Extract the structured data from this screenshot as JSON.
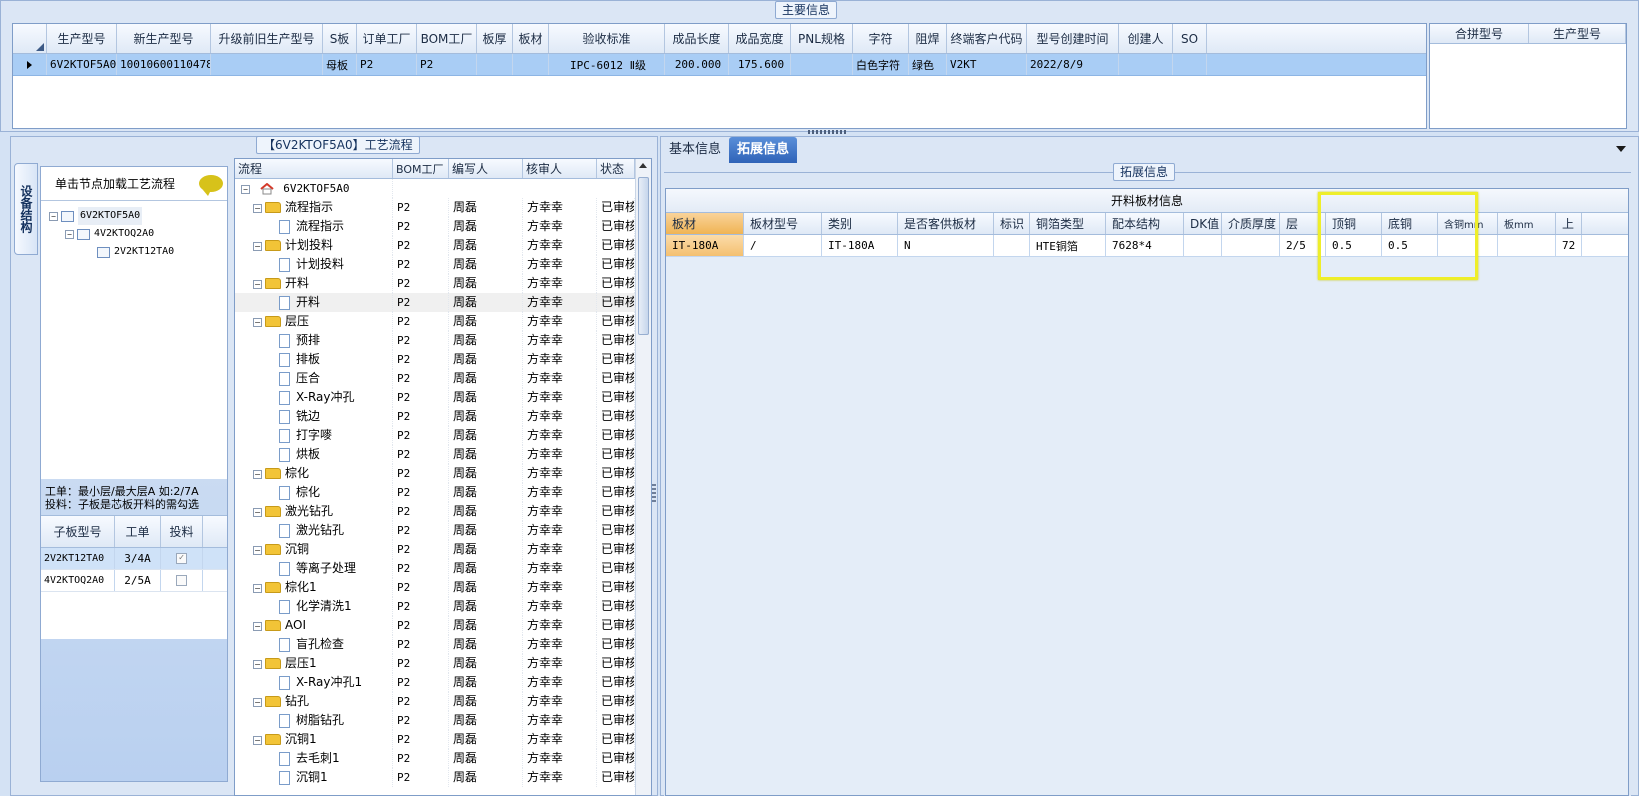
{
  "main_info": {
    "title": "主要信息",
    "columns": [
      "生产型号",
      "新生产型号",
      "升级前旧生产型号",
      "S板",
      "订单工厂",
      "BOM工厂",
      "板厚",
      "板材",
      "验收标准",
      "成品长度",
      "成品宽度",
      "PNL规格",
      "字符",
      "阻焊",
      "终端客户代码",
      "型号创建时间",
      "创建人",
      "SO"
    ],
    "row": [
      "6V2KTOF5A0",
      "10010600110478",
      "",
      "母板",
      "P2",
      "P2",
      "",
      "",
      "IPC-6012 Ⅱ级",
      "200.000",
      "175.600",
      "",
      "白色字符",
      "绿色",
      "V2KT",
      "2022/8/9",
      "",
      ""
    ],
    "right_columns": [
      "合拼型号",
      "生产型号"
    ]
  },
  "structure": {
    "vtab_label": "设备结构",
    "hint": "单击节点加载工艺流程",
    "nodes": [
      "6V2KTOF5A0",
      "4V2KTOQ2A0",
      "2V2KT12TA0"
    ],
    "note_line1": "工单：最小层/最大层A 如:2/7A",
    "note_line2": "投料：子板是芯板开料的需勾选",
    "sub_columns": [
      "子板型号",
      "工单",
      "投料"
    ],
    "sub_rows": [
      {
        "model": "2V2KT12TA0",
        "order": "3/4A",
        "checked": true
      },
      {
        "model": "4V2KTOQ2A0",
        "order": "2/5A",
        "checked": false
      }
    ]
  },
  "flow": {
    "title": "【6V2KTOF5A0】工艺流程",
    "columns": [
      "流程",
      "BOM工厂",
      "编写人",
      "核审人",
      "状态"
    ],
    "root": "6V2KTOF5A0",
    "rows": [
      {
        "name": "流程指示",
        "type": "folder",
        "bom": "P2",
        "writer": "周磊",
        "reviewer": "方幸幸",
        "status": "已审核"
      },
      {
        "name": "流程指示",
        "type": "doc",
        "bom": "P2",
        "writer": "周磊",
        "reviewer": "方幸幸",
        "status": "已审核"
      },
      {
        "name": "计划投料",
        "type": "folder",
        "bom": "P2",
        "writer": "周磊",
        "reviewer": "方幸幸",
        "status": "已审核"
      },
      {
        "name": "计划投料",
        "type": "doc",
        "bom": "P2",
        "writer": "周磊",
        "reviewer": "方幸幸",
        "status": "已审核"
      },
      {
        "name": "开料",
        "type": "folder",
        "bom": "P2",
        "writer": "周磊",
        "reviewer": "方幸幸",
        "status": "已审核"
      },
      {
        "name": "开料",
        "type": "doc",
        "bom": "P2",
        "writer": "周磊",
        "reviewer": "方幸幸",
        "status": "已审核",
        "selected": true
      },
      {
        "name": "层压",
        "type": "folder",
        "bom": "P2",
        "writer": "周磊",
        "reviewer": "方幸幸",
        "status": "已审核"
      },
      {
        "name": "预排",
        "type": "doc",
        "bom": "P2",
        "writer": "周磊",
        "reviewer": "方幸幸",
        "status": "已审核"
      },
      {
        "name": "排板",
        "type": "doc",
        "bom": "P2",
        "writer": "周磊",
        "reviewer": "方幸幸",
        "status": "已审核"
      },
      {
        "name": "压合",
        "type": "doc",
        "bom": "P2",
        "writer": "周磊",
        "reviewer": "方幸幸",
        "status": "已审核"
      },
      {
        "name": "X-Ray冲孔",
        "type": "doc",
        "bom": "P2",
        "writer": "周磊",
        "reviewer": "方幸幸",
        "status": "已审核"
      },
      {
        "name": "铣边",
        "type": "doc",
        "bom": "P2",
        "writer": "周磊",
        "reviewer": "方幸幸",
        "status": "已审核"
      },
      {
        "name": "打字嘜",
        "type": "doc",
        "bom": "P2",
        "writer": "周磊",
        "reviewer": "方幸幸",
        "status": "已审核"
      },
      {
        "name": "烘板",
        "type": "doc",
        "bom": "P2",
        "writer": "周磊",
        "reviewer": "方幸幸",
        "status": "已审核"
      },
      {
        "name": "棕化",
        "type": "folder",
        "bom": "P2",
        "writer": "周磊",
        "reviewer": "方幸幸",
        "status": "已审核"
      },
      {
        "name": "棕化",
        "type": "doc",
        "bom": "P2",
        "writer": "周磊",
        "reviewer": "方幸幸",
        "status": "已审核"
      },
      {
        "name": "激光钻孔",
        "type": "folder",
        "bom": "P2",
        "writer": "周磊",
        "reviewer": "方幸幸",
        "status": "已审核"
      },
      {
        "name": "激光钻孔",
        "type": "doc",
        "bom": "P2",
        "writer": "周磊",
        "reviewer": "方幸幸",
        "status": "已审核"
      },
      {
        "name": "沉铜",
        "type": "folder",
        "bom": "P2",
        "writer": "周磊",
        "reviewer": "方幸幸",
        "status": "已审核"
      },
      {
        "name": "等离子处理",
        "type": "doc",
        "bom": "P2",
        "writer": "周磊",
        "reviewer": "方幸幸",
        "status": "已审核"
      },
      {
        "name": "棕化1",
        "type": "folder",
        "bom": "P2",
        "writer": "周磊",
        "reviewer": "方幸幸",
        "status": "已审核"
      },
      {
        "name": "化学清洗1",
        "type": "doc",
        "bom": "P2",
        "writer": "周磊",
        "reviewer": "方幸幸",
        "status": "已审核"
      },
      {
        "name": "AOI",
        "type": "folder",
        "bom": "P2",
        "writer": "周磊",
        "reviewer": "方幸幸",
        "status": "已审核"
      },
      {
        "name": "盲孔检查",
        "type": "doc",
        "bom": "P2",
        "writer": "周磊",
        "reviewer": "方幸幸",
        "status": "已审核"
      },
      {
        "name": "层压1",
        "type": "folder",
        "bom": "P2",
        "writer": "周磊",
        "reviewer": "方幸幸",
        "status": "已审核"
      },
      {
        "name": "X-Ray冲孔1",
        "type": "doc",
        "bom": "P2",
        "writer": "周磊",
        "reviewer": "方幸幸",
        "status": "已审核"
      },
      {
        "name": "钻孔",
        "type": "folder",
        "bom": "P2",
        "writer": "周磊",
        "reviewer": "方幸幸",
        "status": "已审核"
      },
      {
        "name": "树脂钻孔",
        "type": "doc",
        "bom": "P2",
        "writer": "周磊",
        "reviewer": "方幸幸",
        "status": "已审核"
      },
      {
        "name": "沉铜1",
        "type": "folder",
        "bom": "P2",
        "writer": "周磊",
        "reviewer": "方幸幸",
        "status": "已审核"
      },
      {
        "name": "去毛刺1",
        "type": "doc",
        "bom": "P2",
        "writer": "周磊",
        "reviewer": "方幸幸",
        "status": "已审核"
      },
      {
        "name": "沉铜1",
        "type": "doc",
        "bom": "P2",
        "writer": "周磊",
        "reviewer": "方幸幸",
        "status": "已审核"
      }
    ]
  },
  "tabs": {
    "basic": "基本信息",
    "ext": "拓展信息"
  },
  "ext_info": {
    "title": "拓展信息",
    "material_title": "开料板材信息",
    "columns": [
      "板材",
      "板材型号",
      "类别",
      "是否客供板材",
      "标识",
      "铜箔类型",
      "配本结构",
      "DK值",
      "介质厚度",
      "层",
      "顶铜",
      "底铜",
      "含铜mm",
      "板mm",
      "上"
    ],
    "row": [
      "IT-180A",
      "/",
      "IT-180A",
      "N",
      "",
      "HTE铜箔",
      "7628*4",
      "",
      "",
      "2/5",
      "0.5",
      "0.5",
      "",
      "",
      "72"
    ]
  },
  "colors": {
    "selected_row": "#a9cdf5",
    "material_highlight": "#f4c070",
    "annotation": "#eeee2a",
    "tab_active": "#2f63b8"
  }
}
